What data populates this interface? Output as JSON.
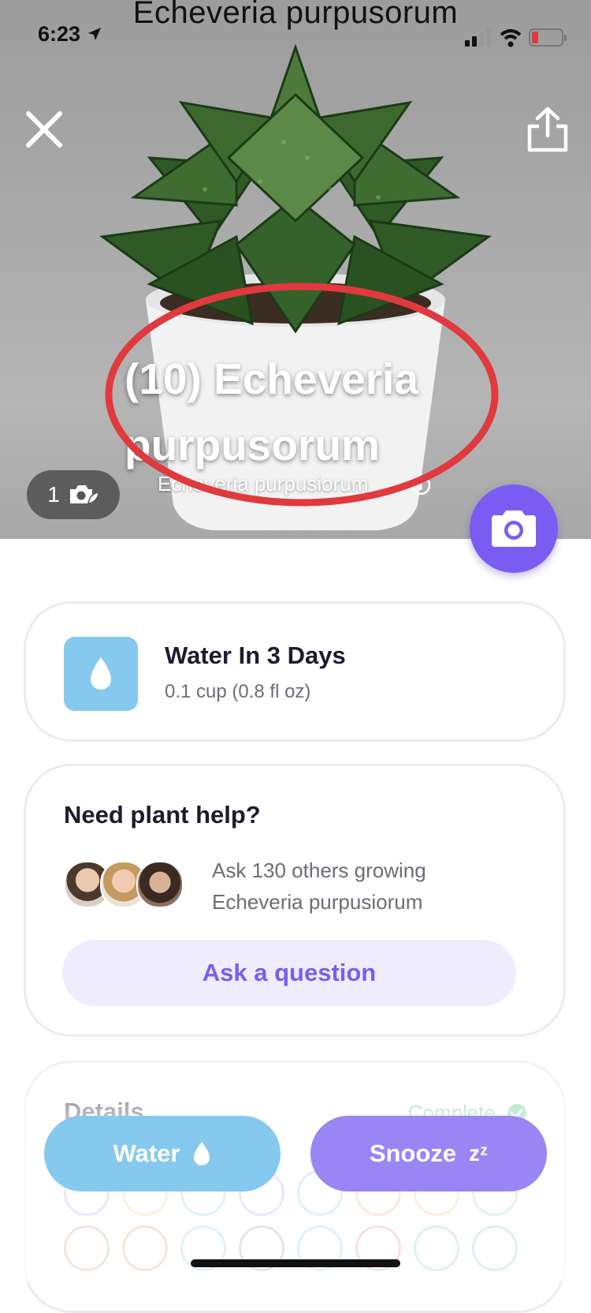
{
  "status_bar": {
    "time": "6:23"
  },
  "photo_caption": "Echeveria purpusorum",
  "hero": {
    "plant_name": "(10) Echeveria purpusorum",
    "species": "Echeveria purpusiorum",
    "photo_count": "1"
  },
  "watering": {
    "title": "Water In 3 Days",
    "amount": "0.1 cup (0.8 fl oz)"
  },
  "help": {
    "title": "Need plant help?",
    "line1": "Ask 130 others growing",
    "line2": "Echeveria purpusiorum",
    "ask_label": "Ask a question"
  },
  "details": {
    "title": "Details",
    "status": "Complete"
  },
  "actions": {
    "water_label": "Water",
    "snooze_label": "Snooze",
    "snooze_glyph": "zᶻ"
  },
  "colors": {
    "accent": "#7a5cf2",
    "water_blue": "#86c9ef",
    "snooze_purple": "#9a85f5",
    "complete_green": "#5cc27f",
    "highlight_red": "#e0393e"
  }
}
